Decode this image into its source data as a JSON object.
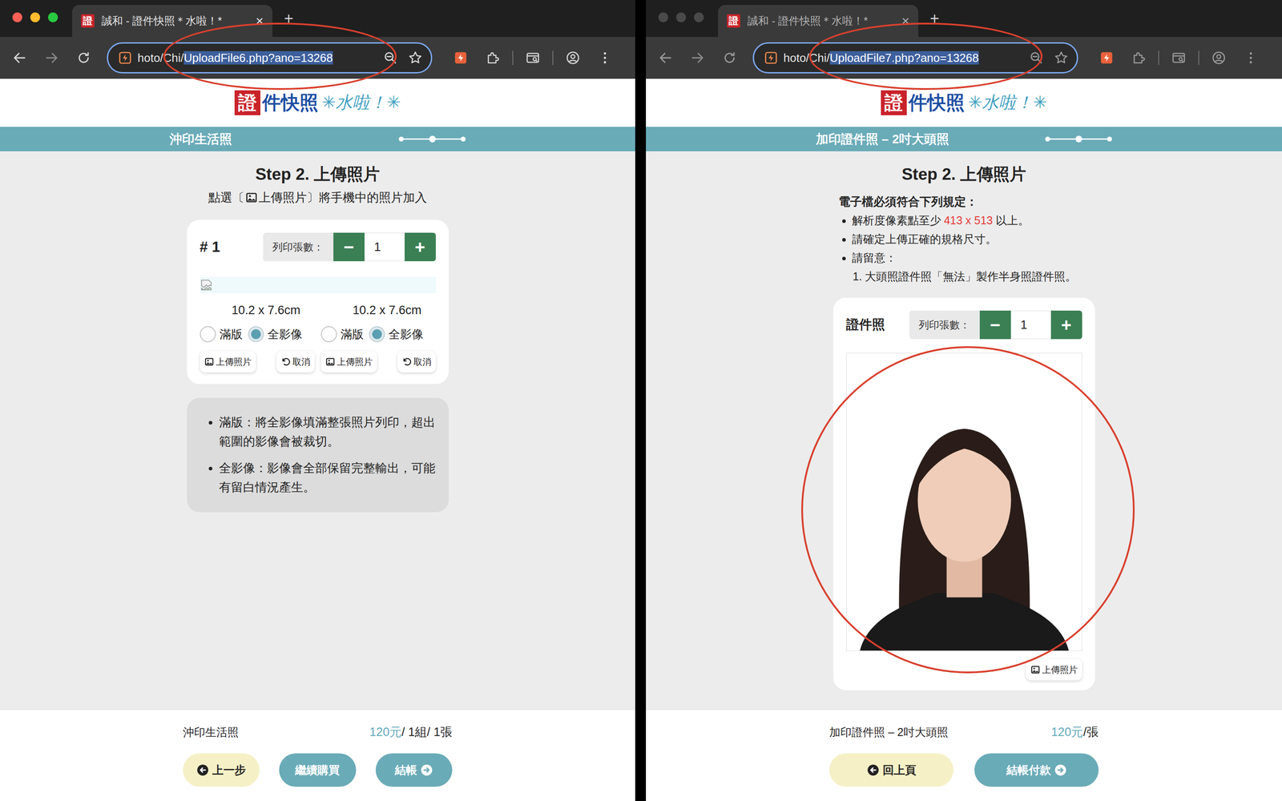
{
  "windows": [
    {
      "active": true,
      "tab": {
        "title": "誠和 - 證件快照＊水啦！*",
        "close": "×",
        "selected": true
      },
      "new_tab": "+",
      "url": {
        "prefix": "hoto/Chi/",
        "selected_text": "UploadFile6.php?ano=13268"
      },
      "logo": {
        "mark": "證",
        "name": "件快照",
        "slogan": "✳水啦！✳"
      },
      "section_bar": {
        "title": "沖印生活照",
        "steps": [
          {
            "selected": false
          },
          {
            "selected": true
          },
          {
            "selected": false
          }
        ]
      },
      "step_title": "Step 2. 上傳照片",
      "page": {
        "kind": "print",
        "instruction": {
          "before": "點選〔",
          "after": "上傳照片〕將手機中的照片加入"
        },
        "card": {
          "index": "# 1",
          "qty_label": "列印張數：",
          "minus": "−",
          "qty": "1",
          "plus": "+",
          "options": [
            {
              "size": "10.2 x 7.6cm",
              "radios": [
                {
                  "label": "滿版",
                  "selected": false
                },
                {
                  "label": "全影像",
                  "selected": true
                }
              ],
              "upload": "上傳照片",
              "cancel": "取消"
            },
            {
              "size": "10.2 x 7.6cm",
              "radios": [
                {
                  "label": "滿版",
                  "selected": false
                },
                {
                  "label": "全影像",
                  "selected": true
                }
              ],
              "upload": "上傳照片",
              "cancel": "取消"
            }
          ]
        },
        "notes": [
          "滿版：將全影像填滿整張照片列印，超出範圍的影像會被裁切。",
          "全影像：影像會全部保留完整輸出，可能有留白情況產生。"
        ]
      },
      "footer": {
        "product": "沖印生活照",
        "price": "120元",
        "unit": "/ 1組/ 1張",
        "buttons": [
          {
            "label": "上一步",
            "kind": "back"
          },
          {
            "label": "繼續購買",
            "kind": "plain"
          },
          {
            "label": "結帳",
            "kind": "next"
          }
        ]
      }
    },
    {
      "active": false,
      "tab": {
        "title": "誠和 - 證件快照＊水啦！*",
        "close": "×",
        "selected": true
      },
      "new_tab": "+",
      "url": {
        "prefix": "hoto/Chi/",
        "selected_text": "UploadFile7.php?ano=13268"
      },
      "logo": {
        "mark": "證",
        "name": "件快照",
        "slogan": "✳水啦！✳"
      },
      "section_bar": {
        "title": "加印證件照 – 2吋大頭照",
        "steps": [
          {
            "selected": false
          },
          {
            "selected": true
          },
          {
            "selected": false
          }
        ]
      },
      "step_title": "Step 2. 上傳照片",
      "page": {
        "kind": "id",
        "rules": {
          "heading": "電子檔必須符合下列規定：",
          "items": [
            {
              "parts": [
                {
                  "text": "解析度像素點至少 ",
                  "highlight": false
                },
                {
                  "text": "413 x 513",
                  "highlight": true
                },
                {
                  "text": " 以上。",
                  "highlight": false
                }
              ],
              "sub": []
            },
            {
              "parts": [
                {
                  "text": "請確定上傳正確的規格尺寸。",
                  "highlight": false
                }
              ],
              "sub": []
            },
            {
              "parts": [
                {
                  "text": "請留意：",
                  "highlight": false
                }
              ],
              "sub": [
                "1. 大頭照證件照「無法」製作半身照證件照。"
              ]
            }
          ]
        },
        "card": {
          "title": "證件照",
          "qty_label": "列印張數：",
          "minus": "−",
          "qty": "1",
          "plus": "+",
          "upload": "上傳照片"
        }
      },
      "footer": {
        "product": "加印證件照 – 2吋大頭照",
        "price": "120元",
        "unit": "/張",
        "buttons": [
          {
            "label": "回上頁",
            "kind": "back"
          },
          {
            "label": "結帳付款",
            "kind": "next"
          }
        ]
      }
    }
  ]
}
